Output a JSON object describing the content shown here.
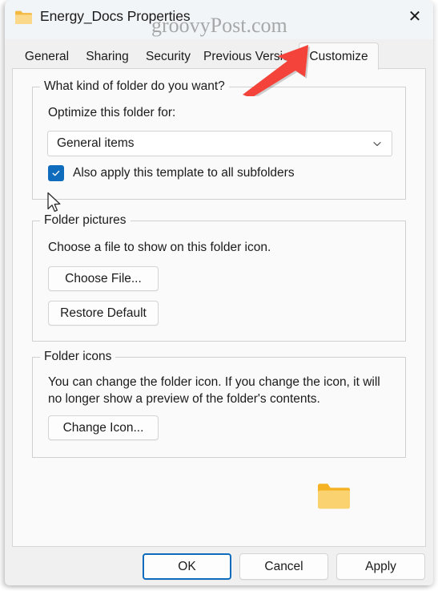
{
  "window": {
    "title": "Energy_Docs Properties",
    "title_icon": "folder-icon",
    "close_label": "✕",
    "watermark": "groovyPost.com"
  },
  "tabs": [
    {
      "label": "General",
      "active": false
    },
    {
      "label": "Sharing",
      "active": false
    },
    {
      "label": "Security",
      "active": false
    },
    {
      "label": "Previous Versions",
      "active": false
    },
    {
      "label": "Customize",
      "active": true
    }
  ],
  "groups": {
    "folder_type": {
      "legend": "What kind of folder do you want?",
      "prompt": "Optimize this folder for:",
      "dropdown": {
        "value": "General items",
        "icon": "chevron-down-icon"
      },
      "checkbox": {
        "label": "Also apply this template to all subfolders",
        "checked": true,
        "check_glyph": "✓"
      }
    },
    "folder_pictures": {
      "legend": "Folder pictures",
      "description": "Choose a file to show on this folder icon.",
      "choose_file_label": "Choose File...",
      "restore_default_label": "Restore Default"
    },
    "folder_icons": {
      "legend": "Folder icons",
      "description": "You can change the folder icon. If you change the icon, it will no longer show a preview of the folder's contents.",
      "change_icon_label": "Change Icon...",
      "preview_icon": "folder-icon"
    }
  },
  "footer": {
    "ok_label": "OK",
    "cancel_label": "Cancel",
    "apply_label": "Apply"
  },
  "annotations": {
    "arrow_color": "#f4433a",
    "arrow_target": "Customize"
  },
  "colors": {
    "accent": "#0f6cbd",
    "titlebar_bg": "#f2f5f8",
    "panel_bg": "#fafafa",
    "chrome_bg": "#f0f0f0",
    "folder_icon": "#f5b323"
  }
}
